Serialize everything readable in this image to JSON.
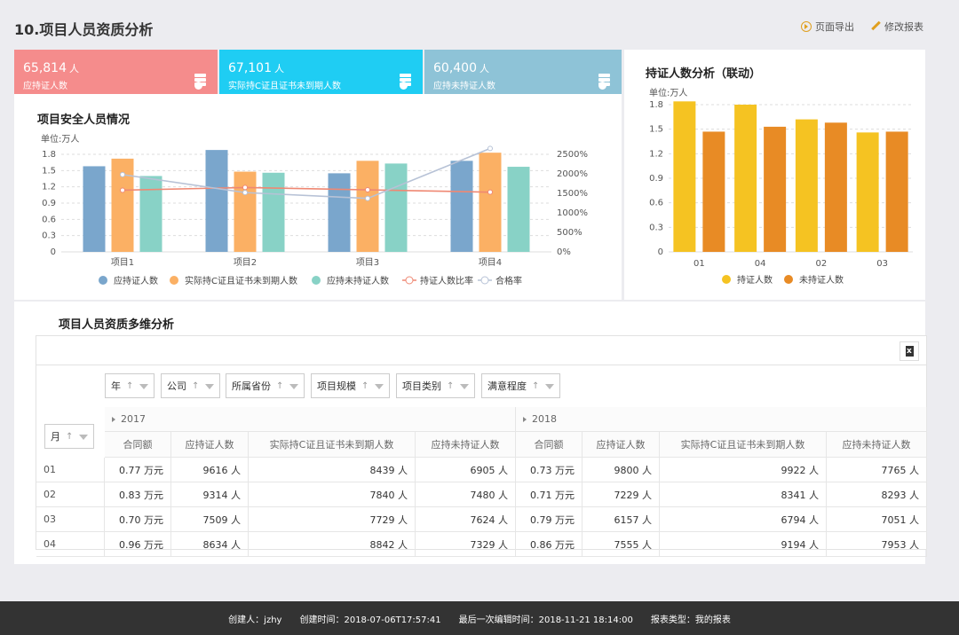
{
  "page": {
    "title": "10.项目人员资质分析",
    "actions": {
      "export_label": "页面导出",
      "edit_label": "修改报表"
    }
  },
  "kpis": [
    {
      "value": "65,814",
      "unit": "人",
      "label": "应持证人数",
      "color": "#f58c8c"
    },
    {
      "value": "67,101",
      "unit": "人",
      "label": "实际持C证且证书未到期人数",
      "color": "#1fcdf3"
    },
    {
      "value": "60,400",
      "unit": "人",
      "label": "应持未持证人数",
      "color": "#8ec3d7"
    }
  ],
  "safety_panel": {
    "title": "项目安全人员情况",
    "unit": "单位:万人"
  },
  "cert_panel": {
    "title": "持证人数分析（联动）",
    "unit": "单位:万人"
  },
  "pivot": {
    "title": "项目人员资质多维分析",
    "fields": [
      "年",
      "公司",
      "所属省份",
      "项目规模",
      "项目类别",
      "满意程度"
    ],
    "row_field": "月",
    "years": [
      "2017",
      "2018"
    ],
    "columns": [
      "合同额",
      "应持证人数",
      "实际持C证且证书未到期人数",
      "应持未持证人数"
    ],
    "rows": [
      {
        "month": "01",
        "cells": [
          "0.77 万元",
          "9616 人",
          "8439 人",
          "6905 人",
          "0.73 万元",
          "9800 人",
          "9922 人",
          "7765 人"
        ]
      },
      {
        "month": "02",
        "cells": [
          "0.83 万元",
          "9314 人",
          "7840 人",
          "7480 人",
          "0.71 万元",
          "7229 人",
          "8341 人",
          "8293 人"
        ]
      },
      {
        "month": "03",
        "cells": [
          "0.70 万元",
          "7509 人",
          "7729 人",
          "7624 人",
          "0.79 万元",
          "6157 人",
          "6794 人",
          "7051 人"
        ]
      },
      {
        "month": "04",
        "cells": [
          "0.96 万元",
          "8634 人",
          "8842 人",
          "7329 人",
          "0.86 万元",
          "7555 人",
          "9194 人",
          "7953 人"
        ]
      }
    ]
  },
  "footer": {
    "creator": "创建人：jzhy",
    "created": "创建时间：2018-07-06T17:57:41",
    "edited": "最后一次编辑时间：2018-11-21 18:14:00",
    "type": "报表类型：我的报表"
  },
  "chart_data": [
    {
      "type": "bar",
      "title": "项目安全人员情况",
      "ylabel": "单位:万人",
      "ylim": [
        0,
        1.8
      ],
      "yticks": [
        "0",
        "0.3",
        "0.6",
        "0.9",
        "1.2",
        "1.5",
        "1.8"
      ],
      "y2ticks": [
        "0%",
        "500%",
        "1000%",
        "1500%",
        "2000%",
        "2500%"
      ],
      "y2lim": [
        0,
        2500
      ],
      "categories": [
        "项目1",
        "项目2",
        "项目3",
        "项目4"
      ],
      "series": [
        {
          "name": "应持证人数",
          "type": "bar",
          "color": "#7aa6cc",
          "values": [
            1.58,
            1.88,
            1.45,
            1.68
          ]
        },
        {
          "name": "实际持C证且证书未到期人数",
          "type": "bar",
          "color": "#fbb064",
          "values": [
            1.72,
            1.48,
            1.68,
            1.83
          ]
        },
        {
          "name": "应持未持证人数",
          "type": "bar",
          "color": "#88d2c6",
          "values": [
            1.4,
            1.46,
            1.63,
            1.57
          ]
        },
        {
          "name": "持证人数比率",
          "type": "line",
          "color": "#ef8873",
          "values": [
            1580,
            1650,
            1590,
            1530
          ]
        },
        {
          "name": "合格率",
          "type": "line",
          "color": "#b7c2d6",
          "values": [
            1980,
            1520,
            1370,
            2650
          ]
        }
      ],
      "legend": "bottom",
      "grid": true
    },
    {
      "type": "bar",
      "title": "持证人数分析（联动）",
      "ylabel": "单位:万人",
      "ylim": [
        0,
        1.8
      ],
      "yticks": [
        "0",
        "0.3",
        "0.6",
        "0.9",
        "1.2",
        "1.5",
        "1.8"
      ],
      "categories": [
        "01",
        "04",
        "02",
        "03"
      ],
      "series": [
        {
          "name": "持证人数",
          "color": "#f5c322",
          "values": [
            1.84,
            1.8,
            1.62,
            1.46
          ]
        },
        {
          "name": "未持证人数",
          "color": "#e88b25",
          "values": [
            1.47,
            1.53,
            1.58,
            1.47
          ]
        }
      ],
      "legend": "bottom",
      "grid": true
    }
  ]
}
